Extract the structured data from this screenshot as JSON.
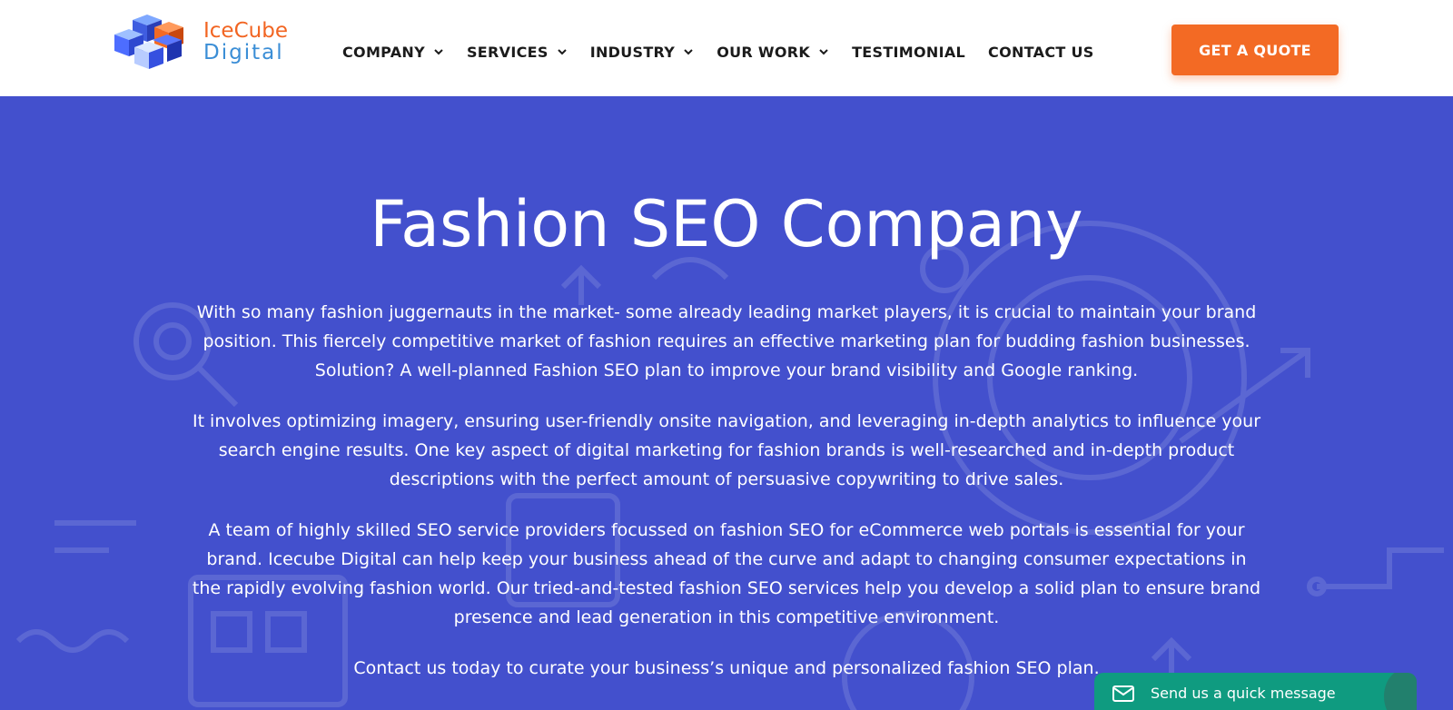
{
  "brand": {
    "logo_line1": "IceCube",
    "logo_line2": "Digital",
    "colors": {
      "orange": "#f36a24",
      "blue": "#4350cd",
      "teal": "#0f9b80"
    }
  },
  "nav": {
    "items": [
      {
        "label": "COMPANY",
        "has_dropdown": true
      },
      {
        "label": "SERVICES",
        "has_dropdown": true
      },
      {
        "label": "INDUSTRY",
        "has_dropdown": true
      },
      {
        "label": "OUR WORK",
        "has_dropdown": true
      },
      {
        "label": "TESTIMONIAL",
        "has_dropdown": false
      },
      {
        "label": "CONTACT US",
        "has_dropdown": false
      }
    ],
    "cta_label": "GET A QUOTE"
  },
  "hero": {
    "title": "Fashion SEO Company",
    "paragraphs": [
      "With so many fashion juggernauts in the market- some already leading market players, it is crucial to maintain your brand position. This fiercely competitive market of fashion requires an effective marketing plan for budding fashion businesses. Solution? A well-planned Fashion SEO plan to improve your brand visibility and Google ranking.",
      "It involves optimizing imagery, ensuring user-friendly onsite navigation, and leveraging in-depth analytics to influence your search engine results. One key aspect of digital marketing for fashion brands is well-researched and in-depth product descriptions with the perfect amount of persuasive copywriting to drive sales.",
      "A team of highly skilled SEO service providers focussed on fashion SEO for eCommerce web portals is essential for your brand. Icecube Digital can help keep your business ahead of the curve and adapt to changing consumer expectations in the rapidly evolving fashion world. Our tried-and-tested fashion SEO services help you develop a solid plan to ensure brand presence and lead generation in this competitive environment.",
      "Contact us today to curate your business’s unique and personalized fashion SEO plan."
    ]
  },
  "chat_widget": {
    "label": "Send us a quick message",
    "icon": "envelope-icon"
  }
}
